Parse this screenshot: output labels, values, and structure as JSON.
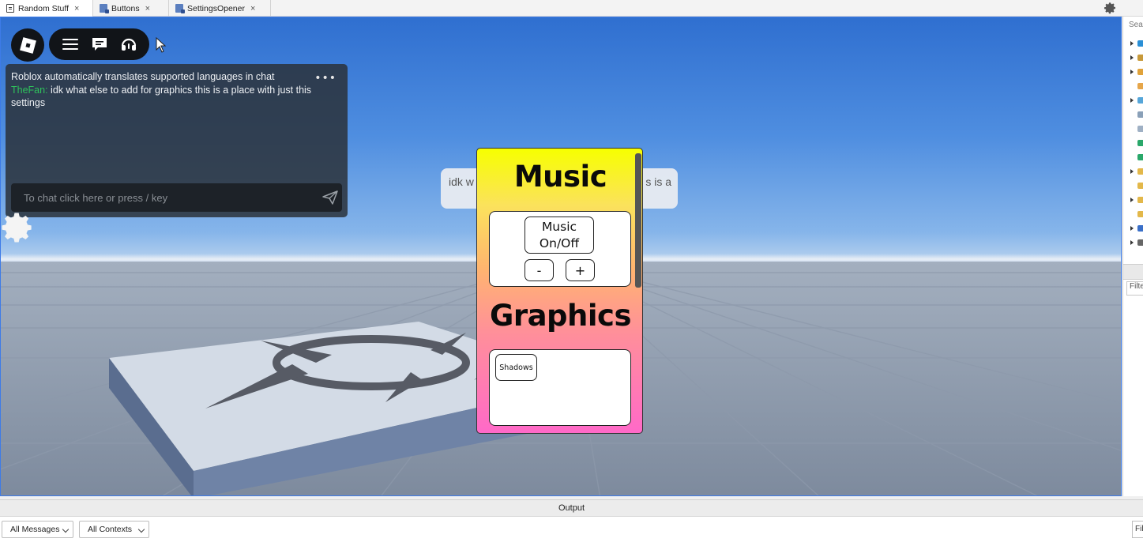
{
  "tabs": [
    {
      "label": "Random Stuff",
      "icon": "place-document-icon",
      "active": true
    },
    {
      "label": "Buttons",
      "icon": "script-icon",
      "active": false
    },
    {
      "label": "SettingsOpener",
      "icon": "script-icon",
      "active": false
    }
  ],
  "tab_close_glyph": "×",
  "chat": {
    "system_message": "Roblox automatically translates supported languages in chat",
    "speaker": "TheFan:",
    "message": " idk what else to add for graphics this is a place with just this settings",
    "more_glyph": "•••",
    "input_placeholder": "To chat click here or press / key",
    "speaker_color": "#2fc25b"
  },
  "bubble": {
    "text_left": "idk w",
    "text_right": "s is a"
  },
  "settings_panel": {
    "music_title": "Music",
    "music_toggle_label": "Music On/Off",
    "volume_down_label": "-",
    "volume_up_label": "+",
    "graphics_title": "Graphics",
    "shadows_label": "Shadows",
    "gradient_colors": [
      "#f7ff00",
      "#ff69c8"
    ]
  },
  "explorer": {
    "search_placeholder": "Search",
    "filter_placeholder": "Filter"
  },
  "output": {
    "title": "Output",
    "messages_filter": "All Messages",
    "contexts_filter": "All Contexts",
    "filter_placeholder": "Filter"
  }
}
